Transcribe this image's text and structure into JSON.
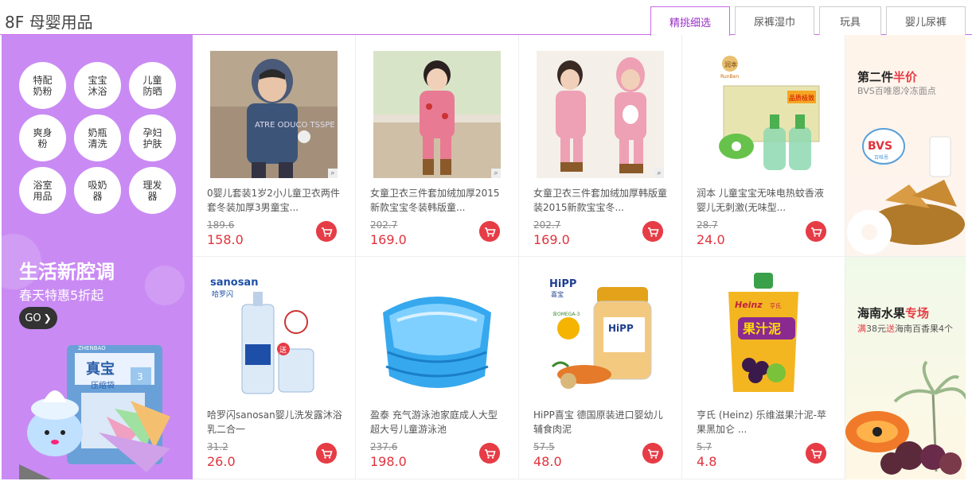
{
  "header": {
    "floor_title": "8F 母婴用品",
    "tabs": [
      {
        "label": "精挑细选"
      },
      {
        "label": "尿裤湿巾"
      },
      {
        "label": "玩具"
      },
      {
        "label": "婴儿尿裤"
      }
    ]
  },
  "left_panel": {
    "categories": [
      "特配奶粉",
      "宝宝沐浴",
      "儿童防晒",
      "爽身粉",
      "奶瓶清洗",
      "孕妇护肤",
      "浴室用品",
      "吸奶器",
      "理发器"
    ],
    "promo_title": "生活新腔调",
    "promo_sub": "春天特惠5折起",
    "go_label": "GO"
  },
  "products": [
    {
      "name": "0婴儿套装1岁2小儿童卫衣两件套冬装加厚3男童宝...",
      "orig": "189.6",
      "price": "158.0"
    },
    {
      "name": "女童卫衣三件套加绒加厚2015新款宝宝冬装韩版童...",
      "orig": "202.7",
      "price": "169.0"
    },
    {
      "name": "女童卫衣三件套加绒加厚韩版童装2015新款宝宝冬...",
      "orig": "202.7",
      "price": "169.0"
    },
    {
      "name": "润本 儿童宝宝无味电热蚊香液婴儿无刺激(无味型...",
      "orig": "28.7",
      "price": "24.0"
    },
    {
      "name": "哈罗闪sanosan婴儿洗发露沐浴乳二合一",
      "orig": "31.2",
      "price": "26.0"
    },
    {
      "name": "盈泰 充气游泳池家庭成人大型超大号儿童游泳池",
      "orig": "237.6",
      "price": "198.0"
    },
    {
      "name": "HiPP喜宝 德国原装进口婴幼儿辅食肉泥",
      "orig": "57.5",
      "price": "48.0"
    },
    {
      "name": "亨氏 (Heinz) 乐维滋果汁泥-苹果黑加仑 ...",
      "orig": "5.7",
      "price": "4.8"
    }
  ],
  "product_images": {
    "sanosan_brand": "sanosan",
    "sanosan_cn": "哈罗闪",
    "sanosan_gift": "送",
    "hipp_brand": "HiPP",
    "hipp_cn": "喜宝",
    "hipp_omega": "含OMEGA-3",
    "hipp_label": "HiPP",
    "heinz_brand": "Heinz",
    "heinz_cn": "亨氏",
    "heinz_product": "果汁泥",
    "runben_brand": "润本",
    "runben_en": "RunBen",
    "runben_box": "品质极致",
    "hoodie_text": "ATRE ODUCO TSSPE"
  },
  "right_ads": [
    {
      "title_main": "第二件",
      "title_hl": "半价",
      "sub": "BVS百唯恩冷冻面点",
      "logo": "BVS",
      "logo_sub": "百唯恩"
    },
    {
      "title_main": "海南水果",
      "title_hl": "专场",
      "sub_a": "满",
      "sub_b": "38元",
      "sub_c": "送",
      "sub_d": "海南百香果4个"
    }
  ],
  "left_image_labels": {
    "box_brand": "真宝",
    "box_sub": "压缩袋",
    "box_tag": "3",
    "box_top": "ZHENBAO"
  },
  "colors": {
    "accent_purple": "#c98bf3",
    "price_red": "#e0333d",
    "cart_red": "#e63c46",
    "tab_border": "#c86be8"
  }
}
